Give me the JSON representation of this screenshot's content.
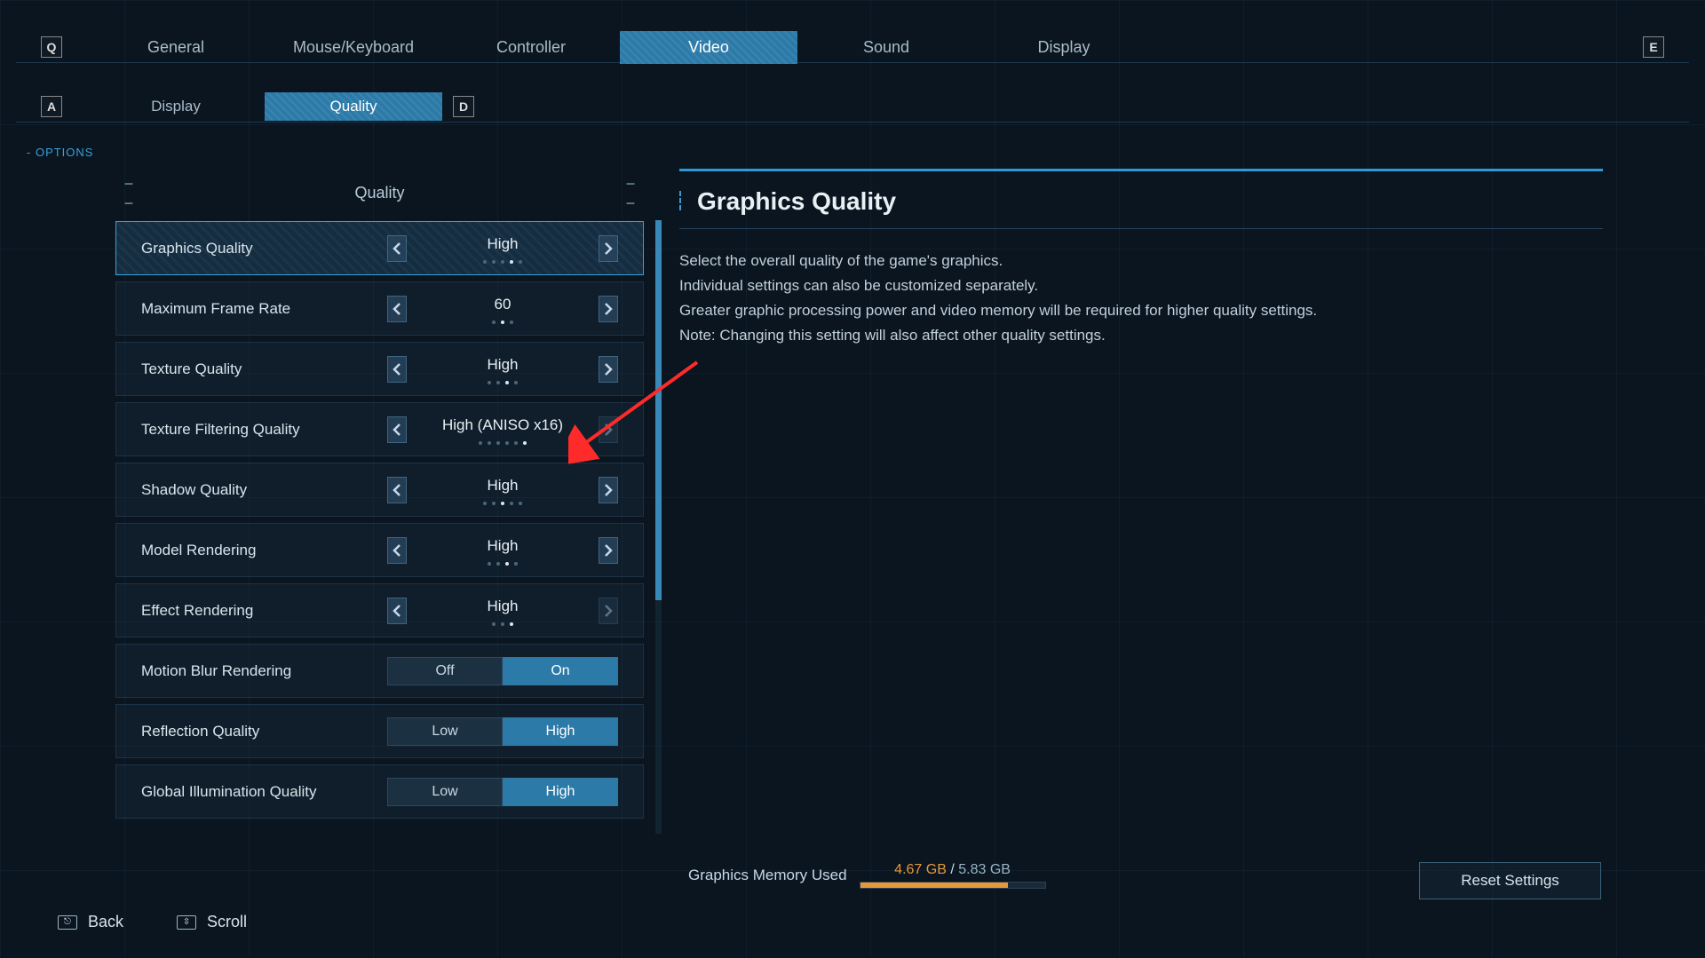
{
  "breadcrumb": "OPTIONS",
  "topTabs": {
    "leftKey": "Q",
    "rightKey": "E",
    "items": [
      "General",
      "Mouse/Keyboard",
      "Controller",
      "Video",
      "Sound",
      "Display"
    ],
    "activeIndex": 3
  },
  "subTabs": {
    "leftKey": "A",
    "rightKey": "D",
    "items": [
      "Display",
      "Quality"
    ],
    "activeIndex": 1
  },
  "sectionTitle": "Quality",
  "settings": [
    {
      "label": "Graphics Quality",
      "type": "stepper",
      "value": "High",
      "dots": 5,
      "dotIndex": 3,
      "selected": true
    },
    {
      "label": "Maximum Frame Rate",
      "type": "stepper",
      "value": "60",
      "dots": 3,
      "dotIndex": 1
    },
    {
      "label": "Texture Quality",
      "type": "stepper",
      "value": "High",
      "dots": 4,
      "dotIndex": 2
    },
    {
      "label": "Texture Filtering Quality",
      "type": "stepper",
      "value": "High (ANISO x16)",
      "dots": 6,
      "dotIndex": 5,
      "rightDim": true
    },
    {
      "label": "Shadow Quality",
      "type": "stepper",
      "value": "High",
      "dots": 5,
      "dotIndex": 2
    },
    {
      "label": "Model Rendering",
      "type": "stepper",
      "value": "High",
      "dots": 4,
      "dotIndex": 2
    },
    {
      "label": "Effect Rendering",
      "type": "stepper",
      "value": "High",
      "dots": 3,
      "dotIndex": 2,
      "rightDim": true
    },
    {
      "label": "Motion Blur Rendering",
      "type": "toggle",
      "options": [
        "Off",
        "On"
      ],
      "activeIndex": 1
    },
    {
      "label": "Reflection Quality",
      "type": "toggle",
      "options": [
        "Low",
        "High"
      ],
      "activeIndex": 1
    },
    {
      "label": "Global Illumination Quality",
      "type": "toggle",
      "options": [
        "Low",
        "High"
      ],
      "activeIndex": 1
    }
  ],
  "info": {
    "title": "Graphics Quality",
    "lines": [
      "Select the overall quality of the game's graphics.",
      "Individual settings can also be customized separately.",
      "Greater graphic processing power and video memory will be required for higher quality settings.",
      "Note: Changing this setting will also affect other quality settings."
    ]
  },
  "memory": {
    "label": "Graphics Memory Used",
    "used": "4.67 GB",
    "sep": "/",
    "total": "5.83 GB",
    "fillPercent": 80
  },
  "resetLabel": "Reset Settings",
  "footer": {
    "back": "Back",
    "scroll": "Scroll"
  }
}
